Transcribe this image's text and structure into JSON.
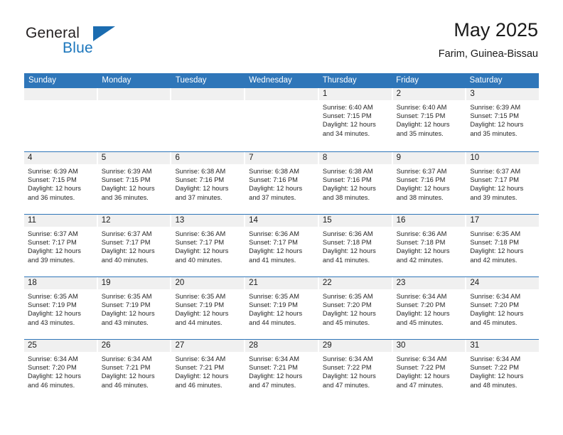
{
  "brand": {
    "name_part1": "General",
    "name_part2": "Blue",
    "logo_icon": "triangle-logo-icon",
    "accent_color": "#1b76bc"
  },
  "header": {
    "title": "May 2025",
    "location": "Farim, Guinea-Bissau"
  },
  "theme": {
    "header_blue": "#2f76b9",
    "day_strip_gray": "#f0f0f0",
    "text_color": "#1a1a1a"
  },
  "calendar": {
    "weekdays": [
      "Sunday",
      "Monday",
      "Tuesday",
      "Wednesday",
      "Thursday",
      "Friday",
      "Saturday"
    ],
    "weeks": [
      [
        {
          "day": "",
          "empty": true
        },
        {
          "day": "",
          "empty": true
        },
        {
          "day": "",
          "empty": true
        },
        {
          "day": "",
          "empty": true
        },
        {
          "day": "1",
          "sunrise": "Sunrise: 6:40 AM",
          "sunset": "Sunset: 7:15 PM",
          "daylight": "Daylight: 12 hours and 34 minutes."
        },
        {
          "day": "2",
          "sunrise": "Sunrise: 6:40 AM",
          "sunset": "Sunset: 7:15 PM",
          "daylight": "Daylight: 12 hours and 35 minutes."
        },
        {
          "day": "3",
          "sunrise": "Sunrise: 6:39 AM",
          "sunset": "Sunset: 7:15 PM",
          "daylight": "Daylight: 12 hours and 35 minutes."
        }
      ],
      [
        {
          "day": "4",
          "sunrise": "Sunrise: 6:39 AM",
          "sunset": "Sunset: 7:15 PM",
          "daylight": "Daylight: 12 hours and 36 minutes."
        },
        {
          "day": "5",
          "sunrise": "Sunrise: 6:39 AM",
          "sunset": "Sunset: 7:15 PM",
          "daylight": "Daylight: 12 hours and 36 minutes."
        },
        {
          "day": "6",
          "sunrise": "Sunrise: 6:38 AM",
          "sunset": "Sunset: 7:16 PM",
          "daylight": "Daylight: 12 hours and 37 minutes."
        },
        {
          "day": "7",
          "sunrise": "Sunrise: 6:38 AM",
          "sunset": "Sunset: 7:16 PM",
          "daylight": "Daylight: 12 hours and 37 minutes."
        },
        {
          "day": "8",
          "sunrise": "Sunrise: 6:38 AM",
          "sunset": "Sunset: 7:16 PM",
          "daylight": "Daylight: 12 hours and 38 minutes."
        },
        {
          "day": "9",
          "sunrise": "Sunrise: 6:37 AM",
          "sunset": "Sunset: 7:16 PM",
          "daylight": "Daylight: 12 hours and 38 minutes."
        },
        {
          "day": "10",
          "sunrise": "Sunrise: 6:37 AM",
          "sunset": "Sunset: 7:17 PM",
          "daylight": "Daylight: 12 hours and 39 minutes."
        }
      ],
      [
        {
          "day": "11",
          "sunrise": "Sunrise: 6:37 AM",
          "sunset": "Sunset: 7:17 PM",
          "daylight": "Daylight: 12 hours and 39 minutes."
        },
        {
          "day": "12",
          "sunrise": "Sunrise: 6:37 AM",
          "sunset": "Sunset: 7:17 PM",
          "daylight": "Daylight: 12 hours and 40 minutes."
        },
        {
          "day": "13",
          "sunrise": "Sunrise: 6:36 AM",
          "sunset": "Sunset: 7:17 PM",
          "daylight": "Daylight: 12 hours and 40 minutes."
        },
        {
          "day": "14",
          "sunrise": "Sunrise: 6:36 AM",
          "sunset": "Sunset: 7:17 PM",
          "daylight": "Daylight: 12 hours and 41 minutes."
        },
        {
          "day": "15",
          "sunrise": "Sunrise: 6:36 AM",
          "sunset": "Sunset: 7:18 PM",
          "daylight": "Daylight: 12 hours and 41 minutes."
        },
        {
          "day": "16",
          "sunrise": "Sunrise: 6:36 AM",
          "sunset": "Sunset: 7:18 PM",
          "daylight": "Daylight: 12 hours and 42 minutes."
        },
        {
          "day": "17",
          "sunrise": "Sunrise: 6:35 AM",
          "sunset": "Sunset: 7:18 PM",
          "daylight": "Daylight: 12 hours and 42 minutes."
        }
      ],
      [
        {
          "day": "18",
          "sunrise": "Sunrise: 6:35 AM",
          "sunset": "Sunset: 7:19 PM",
          "daylight": "Daylight: 12 hours and 43 minutes."
        },
        {
          "day": "19",
          "sunrise": "Sunrise: 6:35 AM",
          "sunset": "Sunset: 7:19 PM",
          "daylight": "Daylight: 12 hours and 43 minutes."
        },
        {
          "day": "20",
          "sunrise": "Sunrise: 6:35 AM",
          "sunset": "Sunset: 7:19 PM",
          "daylight": "Daylight: 12 hours and 44 minutes."
        },
        {
          "day": "21",
          "sunrise": "Sunrise: 6:35 AM",
          "sunset": "Sunset: 7:19 PM",
          "daylight": "Daylight: 12 hours and 44 minutes."
        },
        {
          "day": "22",
          "sunrise": "Sunrise: 6:35 AM",
          "sunset": "Sunset: 7:20 PM",
          "daylight": "Daylight: 12 hours and 45 minutes."
        },
        {
          "day": "23",
          "sunrise": "Sunrise: 6:34 AM",
          "sunset": "Sunset: 7:20 PM",
          "daylight": "Daylight: 12 hours and 45 minutes."
        },
        {
          "day": "24",
          "sunrise": "Sunrise: 6:34 AM",
          "sunset": "Sunset: 7:20 PM",
          "daylight": "Daylight: 12 hours and 45 minutes."
        }
      ],
      [
        {
          "day": "25",
          "sunrise": "Sunrise: 6:34 AM",
          "sunset": "Sunset: 7:20 PM",
          "daylight": "Daylight: 12 hours and 46 minutes."
        },
        {
          "day": "26",
          "sunrise": "Sunrise: 6:34 AM",
          "sunset": "Sunset: 7:21 PM",
          "daylight": "Daylight: 12 hours and 46 minutes."
        },
        {
          "day": "27",
          "sunrise": "Sunrise: 6:34 AM",
          "sunset": "Sunset: 7:21 PM",
          "daylight": "Daylight: 12 hours and 46 minutes."
        },
        {
          "day": "28",
          "sunrise": "Sunrise: 6:34 AM",
          "sunset": "Sunset: 7:21 PM",
          "daylight": "Daylight: 12 hours and 47 minutes."
        },
        {
          "day": "29",
          "sunrise": "Sunrise: 6:34 AM",
          "sunset": "Sunset: 7:22 PM",
          "daylight": "Daylight: 12 hours and 47 minutes."
        },
        {
          "day": "30",
          "sunrise": "Sunrise: 6:34 AM",
          "sunset": "Sunset: 7:22 PM",
          "daylight": "Daylight: 12 hours and 47 minutes."
        },
        {
          "day": "31",
          "sunrise": "Sunrise: 6:34 AM",
          "sunset": "Sunset: 7:22 PM",
          "daylight": "Daylight: 12 hours and 48 minutes."
        }
      ]
    ]
  }
}
